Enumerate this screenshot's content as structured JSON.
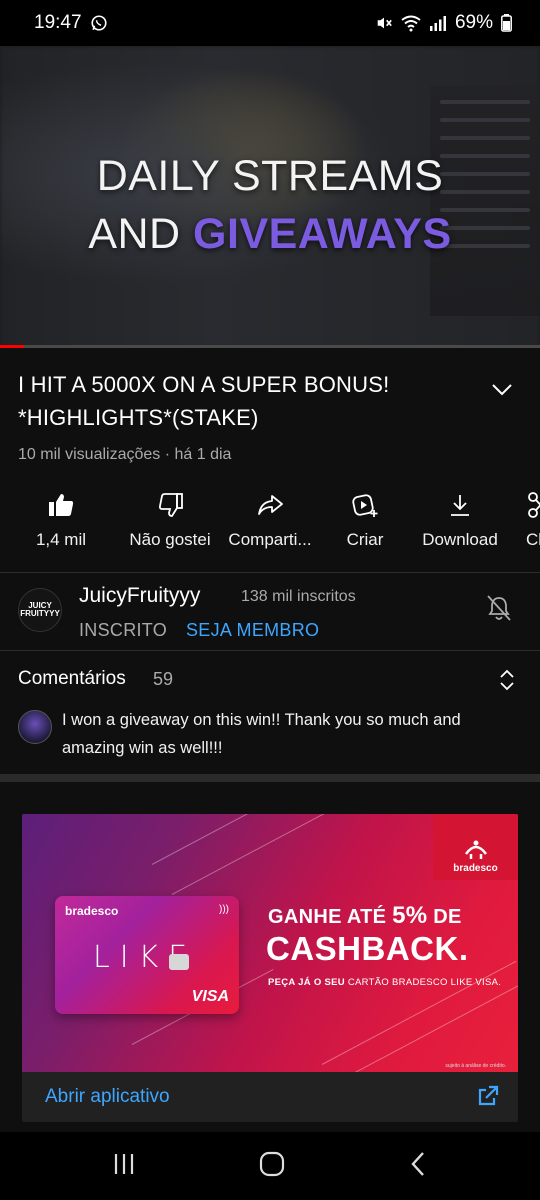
{
  "status_bar": {
    "time": "19:47",
    "battery": "69%"
  },
  "video": {
    "overlay_line1": "DAILY STREAMS",
    "overlay_line2_prefix": "AND ",
    "overlay_line2_accent": "GIVEAWAYS",
    "accent_color": "#7b5ce0",
    "progress_fraction": 0.045
  },
  "title_block": {
    "title": "I HIT A 5000X ON A SUPER BONUS! *HIGHLIGHTS*(STAKE)",
    "meta": "10 mil visualizações · há 1 dia"
  },
  "actions": [
    {
      "label": "1,4 mil",
      "icon": "thumbs-up-icon"
    },
    {
      "label": "Não gostei",
      "icon": "thumbs-down-icon"
    },
    {
      "label": "Comparti...",
      "icon": "share-icon"
    },
    {
      "label": "Criar",
      "icon": "create-icon"
    },
    {
      "label": "Download",
      "icon": "download-icon"
    },
    {
      "label": "Cli",
      "icon": "clip-icon"
    }
  ],
  "channel": {
    "avatar_text": "JUICY FRUITYYY",
    "name": "JuicyFruityyy",
    "subscribers": "138 mil inscritos",
    "subscribed_label": "INSCRITO",
    "join_label": "SEJA MEMBRO"
  },
  "comments": {
    "title": "Comentários",
    "count": "59",
    "top_comment": "I won a giveaway on this win!! Thank you so much and amazing win as well!!!"
  },
  "ad": {
    "brand": "bradesco",
    "card_brand": "bradesco",
    "card_word": "LIKE",
    "card_network": "VISA",
    "headline_prefix": "GANHE ATÉ ",
    "headline_number": "5%",
    "headline_suffix": " DE",
    "headline_big": "CASHBACK.",
    "sub_bold": "PEÇA JÁ O SEU",
    "sub_rest": " CARTÃO BRADESCO LIKE VISA.",
    "fine_print": "sujeito à análise de crédito.",
    "open_app_label": "Abrir aplicativo"
  },
  "colors": {
    "accent_blue": "#3ea6ff",
    "youtube_red": "#ff0000",
    "background": "#0f0f0f"
  }
}
